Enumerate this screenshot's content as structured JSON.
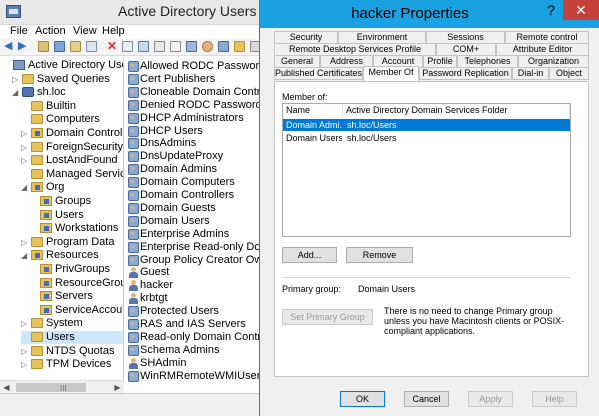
{
  "main": {
    "title": "Active Directory Users and C",
    "menu": [
      "File",
      "Action",
      "View",
      "Help"
    ],
    "tree": [
      {
        "label": "Active Directory Users and",
        "icon": "console-root-icon",
        "indent": 0,
        "expander": ""
      },
      {
        "label": "Saved Queries",
        "icon": "folder-icon",
        "indent": 1,
        "expander": "▷"
      },
      {
        "label": "sh.loc",
        "icon": "domain-icon",
        "indent": 1,
        "expander": "◢"
      },
      {
        "label": "Builtin",
        "icon": "folder-icon",
        "indent": 2,
        "expander": ""
      },
      {
        "label": "Computers",
        "icon": "folder-icon",
        "indent": 2,
        "expander": ""
      },
      {
        "label": "Domain Controller",
        "icon": "ou-icon",
        "indent": 2,
        "expander": "▷"
      },
      {
        "label": "ForeignSecurityPrin",
        "icon": "folder-icon",
        "indent": 2,
        "expander": "▷"
      },
      {
        "label": "LostAndFound",
        "icon": "folder-icon",
        "indent": 2,
        "expander": "▷"
      },
      {
        "label": "Managed Service A",
        "icon": "folder-icon",
        "indent": 2,
        "expander": ""
      },
      {
        "label": "Org",
        "icon": "ou-icon",
        "indent": 2,
        "expander": "◢"
      },
      {
        "label": "Groups",
        "icon": "ou-icon",
        "indent": 3,
        "expander": ""
      },
      {
        "label": "Users",
        "icon": "ou-icon",
        "indent": 3,
        "expander": ""
      },
      {
        "label": "Workstations",
        "icon": "ou-icon",
        "indent": 3,
        "expander": ""
      },
      {
        "label": "Program Data",
        "icon": "folder-icon",
        "indent": 2,
        "expander": "▷"
      },
      {
        "label": "Resources",
        "icon": "ou-icon",
        "indent": 2,
        "expander": "◢"
      },
      {
        "label": "PrivGroups",
        "icon": "ou-icon",
        "indent": 3,
        "expander": ""
      },
      {
        "label": "ResourceGroup",
        "icon": "ou-icon",
        "indent": 3,
        "expander": ""
      },
      {
        "label": "Servers",
        "icon": "ou-icon",
        "indent": 3,
        "expander": ""
      },
      {
        "label": "ServiceAccount",
        "icon": "ou-icon",
        "indent": 3,
        "expander": ""
      },
      {
        "label": "System",
        "icon": "folder-icon",
        "indent": 2,
        "expander": "▷"
      },
      {
        "label": "Users",
        "icon": "folder-icon",
        "indent": 2,
        "expander": "",
        "selected": true
      },
      {
        "label": "NTDS Quotas",
        "icon": "folder-icon",
        "indent": 2,
        "expander": "▷"
      },
      {
        "label": "TPM Devices",
        "icon": "folder-icon",
        "indent": 2,
        "expander": "▷"
      }
    ],
    "list": [
      {
        "label": "Allowed RODC Password Repl",
        "icon": "group-icon"
      },
      {
        "label": "Cert Publishers",
        "icon": "group-icon"
      },
      {
        "label": "Cloneable Domain Controllers",
        "icon": "group-icon"
      },
      {
        "label": "Denied RODC Password Replic",
        "icon": "group-icon"
      },
      {
        "label": "DHCP Administrators",
        "icon": "group-icon"
      },
      {
        "label": "DHCP Users",
        "icon": "group-icon"
      },
      {
        "label": "DnsAdmins",
        "icon": "group-icon"
      },
      {
        "label": "DnsUpdateProxy",
        "icon": "group-icon"
      },
      {
        "label": "Domain Admins",
        "icon": "group-icon"
      },
      {
        "label": "Domain Computers",
        "icon": "group-icon"
      },
      {
        "label": "Domain Controllers",
        "icon": "group-icon"
      },
      {
        "label": "Domain Guests",
        "icon": "group-icon"
      },
      {
        "label": "Domain Users",
        "icon": "group-icon"
      },
      {
        "label": "Enterprise Admins",
        "icon": "group-icon"
      },
      {
        "label": "Enterprise Read-only Domain",
        "icon": "group-icon"
      },
      {
        "label": "Group Policy Creator Owners",
        "icon": "group-icon"
      },
      {
        "label": "Guest",
        "icon": "user-icon"
      },
      {
        "label": "hacker",
        "icon": "user-icon"
      },
      {
        "label": "krbtgt",
        "icon": "user-icon"
      },
      {
        "label": "Protected Users",
        "icon": "group-icon"
      },
      {
        "label": "RAS and IAS Servers",
        "icon": "group-icon"
      },
      {
        "label": "Read-only Domain Controllers",
        "icon": "group-icon"
      },
      {
        "label": "Schema Admins",
        "icon": "group-icon"
      },
      {
        "label": "SHAdmin",
        "icon": "user-icon"
      },
      {
        "label": "WinRMRemoteWMIUsers__",
        "icon": "group-icon"
      }
    ]
  },
  "dialog": {
    "title": "hacker Properties",
    "help_label": "?",
    "close_label": "✕",
    "tabs_row1": [
      "Security",
      "Environment",
      "Sessions",
      "Remote control"
    ],
    "tabs_row2": [
      "Remote Desktop Services Profile",
      "COM+",
      "Attribute Editor"
    ],
    "tabs_row3": [
      "General",
      "Address",
      "Account",
      "Profile",
      "Telephones",
      "Organization"
    ],
    "tabs_row4": [
      "Published Certificates",
      "Member Of",
      "Password Replication",
      "Dial-in",
      "Object"
    ],
    "member_of_label": "Member of:",
    "columns": [
      "Name",
      "Active Directory Domain Services Folder"
    ],
    "members": [
      {
        "name": "Domain Admi...",
        "folder": "sh.loc/Users",
        "selected": true
      },
      {
        "name": "Domain Users",
        "folder": "sh.loc/Users",
        "selected": false
      }
    ],
    "add_label": "Add...",
    "remove_label": "Remove",
    "primary_group_label": "Primary group:",
    "primary_group_value": "Domain Users",
    "set_primary_label": "Set Primary Group",
    "note": "There is no need to change Primary group unless you have Macintosh clients or POSIX-compliant applications.",
    "ok_label": "OK",
    "cancel_label": "Cancel",
    "apply_label": "Apply",
    "help_button_label": "Help"
  }
}
